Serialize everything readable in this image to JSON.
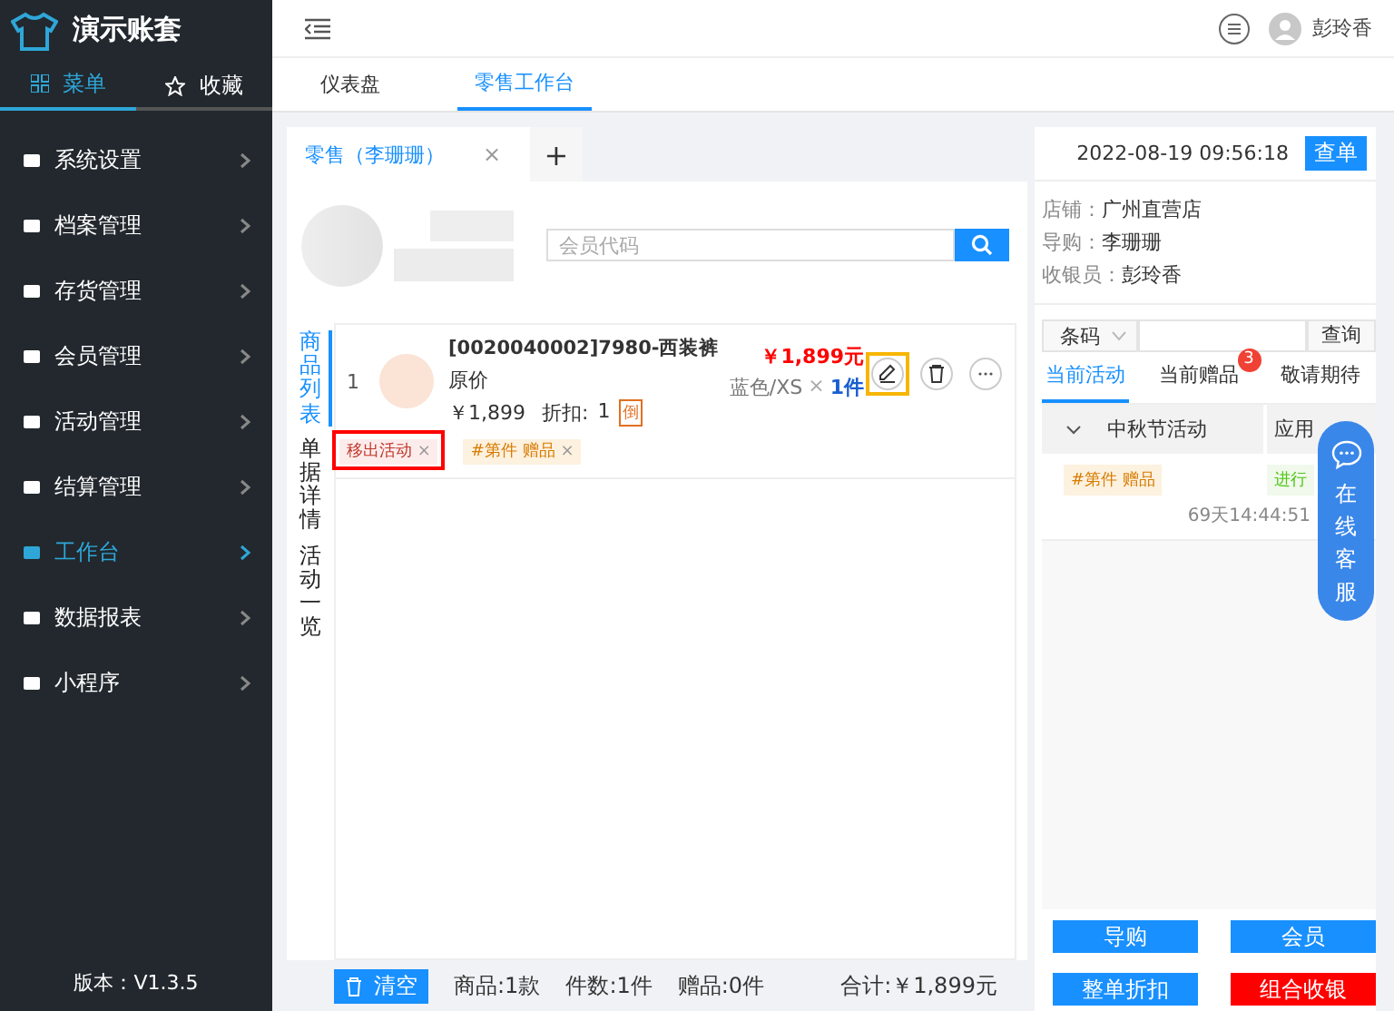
{
  "sidebar": {
    "app_title": "演示账套",
    "tabs": [
      {
        "label": "菜单",
        "selected": true
      },
      {
        "label": "收藏",
        "selected": false
      }
    ],
    "items": [
      {
        "label": "系统设置",
        "selected": false
      },
      {
        "label": "档案管理",
        "selected": false
      },
      {
        "label": "存货管理",
        "selected": false
      },
      {
        "label": "会员管理",
        "selected": false
      },
      {
        "label": "活动管理",
        "selected": false
      },
      {
        "label": "结算管理",
        "selected": false
      },
      {
        "label": "工作台",
        "selected": true
      },
      {
        "label": "数据报表",
        "selected": false
      },
      {
        "label": "小程序",
        "selected": false
      }
    ],
    "version": "版本：V1.3.5"
  },
  "header": {
    "user": "彭玲香"
  },
  "page_tabs": [
    {
      "label": "仪表盘",
      "selected": false
    },
    {
      "label": "零售工作台",
      "selected": true
    }
  ],
  "order_tabs": [
    {
      "label": "零售（李珊珊）",
      "close": "×",
      "selected": true
    }
  ],
  "add_tab": "+",
  "datetime": "2022-08-19 09:56:18",
  "lookup_button": "查单",
  "member_search": {
    "placeholder": "会员代码"
  },
  "side_tabs": [
    {
      "label": "商品列表",
      "selected": true
    },
    {
      "label": "单据详情",
      "selected": false
    },
    {
      "label": "活动一览",
      "selected": false
    }
  ],
  "items": [
    {
      "index": "1",
      "name": "[0020040002]7980-西装裤",
      "price_type": "原价",
      "unit_price": "￥1,899",
      "discount_label": "折扣:",
      "discount": "1",
      "discount_badge": "倒",
      "total": "￥1,899元",
      "spec": "蓝色/XS",
      "times": "×",
      "qty": "1件",
      "actions": [
        {
          "kind": "edit",
          "highlighted": true
        },
        {
          "kind": "delete",
          "highlighted": false
        },
        {
          "kind": "more",
          "highlighted": false
        }
      ],
      "tags": [
        {
          "label": "移出活动",
          "close": "×",
          "kind": "remove",
          "highlighted": true
        },
        {
          "label": "#第件 赠品",
          "close": "×",
          "kind": "gift",
          "highlighted": false
        }
      ]
    }
  ],
  "footer": {
    "clear_button": "清空",
    "products": "商品:1款",
    "pieces": "件数:1件",
    "gifts": "赠品:0件",
    "total": "合计:￥1,899元"
  },
  "info": {
    "store": {
      "label": "店铺：",
      "value": "广州直营店"
    },
    "guide": {
      "label": "导购：",
      "value": "李珊珊"
    },
    "cashier": {
      "label": "收银员：",
      "value": "彭玲香"
    }
  },
  "barcode": {
    "type": "条码",
    "button": "查询"
  },
  "activity_tabs": [
    {
      "label": "当前活动",
      "selected": true
    },
    {
      "label": "当前赠品",
      "selected": false,
      "badge": "3"
    },
    {
      "label": "敬请期待",
      "selected": false
    }
  ],
  "activities": [
    {
      "name": "中秋节活动",
      "expanded": true,
      "action": "应用",
      "tag": "#第件 赠品",
      "status": "进行",
      "countdown": "69天14:44:51"
    }
  ],
  "buttons": [
    {
      "label": "导购",
      "kind": "primary"
    },
    {
      "label": "会员",
      "kind": "primary"
    },
    {
      "label": "整单折扣",
      "kind": "primary"
    },
    {
      "label": "组合收银",
      "kind": "danger"
    }
  ],
  "chat": {
    "label": "在线客服"
  }
}
